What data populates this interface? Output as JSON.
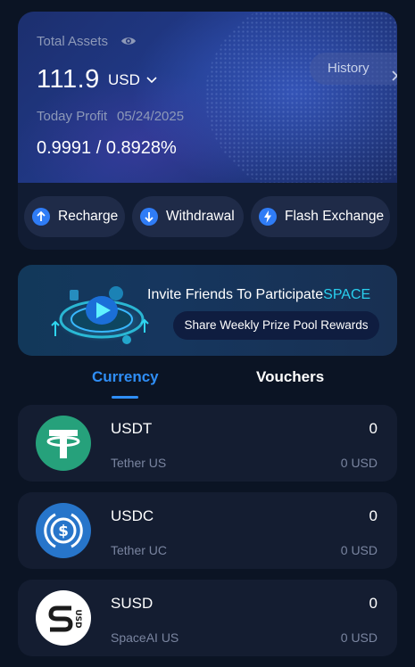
{
  "assets": {
    "total_label": "Total Assets",
    "balance": "111.9",
    "currency": "USD",
    "history_label": "History",
    "today_profit_label": "Today Profit",
    "date": "05/24/2025",
    "profit_value": "0.9991 / 0.8928%"
  },
  "actions": [
    {
      "label": "Recharge",
      "icon": "arrow-up-circle-icon"
    },
    {
      "label": "Withdrawal",
      "icon": "arrow-down-circle-icon"
    },
    {
      "label": "Flash Exchange",
      "icon": "lightning-circle-icon"
    }
  ],
  "banner": {
    "title": "Invite Friends To Participate",
    "title_highlight": "SPACE",
    "subtitle": "Share Weekly Prize Pool Rewards"
  },
  "tabs": [
    {
      "label": "Currency",
      "active": true
    },
    {
      "label": "Vouchers",
      "active": false
    }
  ],
  "asset_list": [
    {
      "symbol": "USDT",
      "name": "Tether US",
      "amount": "0",
      "fiat": "0 USD",
      "icon": "tether-logo-icon",
      "color": "#26a17b"
    },
    {
      "symbol": "USDC",
      "name": "Tether UC",
      "amount": "0",
      "fiat": "0 USD",
      "icon": "usdc-logo-icon",
      "color": "#2775ca"
    },
    {
      "symbol": "SUSD",
      "name": "SpaceAI US",
      "amount": "0",
      "fiat": "0 USD",
      "icon": "susd-logo-icon",
      "color": "#ffffff"
    }
  ],
  "colors": {
    "accent": "#2f8ef6",
    "highlight": "#29d0ef",
    "background": "#0b1424",
    "card": "#141d31"
  }
}
